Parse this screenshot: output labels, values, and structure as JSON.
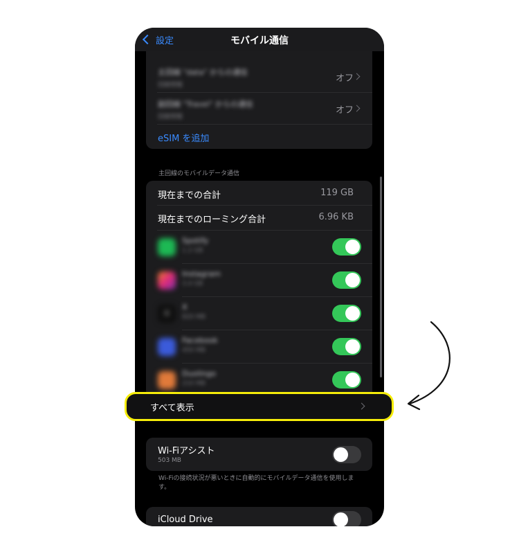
{
  "nav": {
    "back_label": "設定",
    "title": "モバイル通信"
  },
  "sim_section": {
    "lines": [
      {
        "label": "主回線 \"data\" からの通信",
        "sub": "回線情報",
        "value": "オフ"
      },
      {
        "label": "副回線 \"Travel\" からの通信",
        "sub": "回線情報",
        "value": "オフ"
      }
    ],
    "add_esim": "eSIM を追加"
  },
  "data_section": {
    "header": "主回線のモバイルデータ通信",
    "current_total_label": "現在までの合計",
    "current_total_value": "119 GB",
    "roaming_total_label": "現在までのローミング合計",
    "roaming_total_value": "6.96 KB",
    "apps": [
      {
        "name": "Spotify",
        "usage": "1.2 GB",
        "color": "#1db954",
        "enabled": true
      },
      {
        "name": "Instagram",
        "usage": "3.4 GB",
        "color": "#c13584",
        "enabled": true
      },
      {
        "name": "X",
        "usage": "820 MB",
        "color": "#1a1a1a",
        "enabled": true
      },
      {
        "name": "Facebook",
        "usage": "450 MB",
        "color": "#3b5bdb",
        "enabled": true
      },
      {
        "name": "Duolingo",
        "usage": "210 MB",
        "color": "#e07a3a",
        "enabled": true
      }
    ],
    "show_all": "すべて表示"
  },
  "wifi_assist": {
    "label": "Wi-Fiアシスト",
    "usage": "503 MB",
    "enabled": false,
    "footnote": "Wi-Fiの接続状況が悪いときに自動的にモバイルデータ通信を使用します。"
  },
  "icloud_drive": {
    "label": "iCloud Drive",
    "enabled": false
  },
  "colors": {
    "accent": "#3a8bff",
    "toggle_on": "#34c759",
    "highlight": "#f5ec0a"
  }
}
